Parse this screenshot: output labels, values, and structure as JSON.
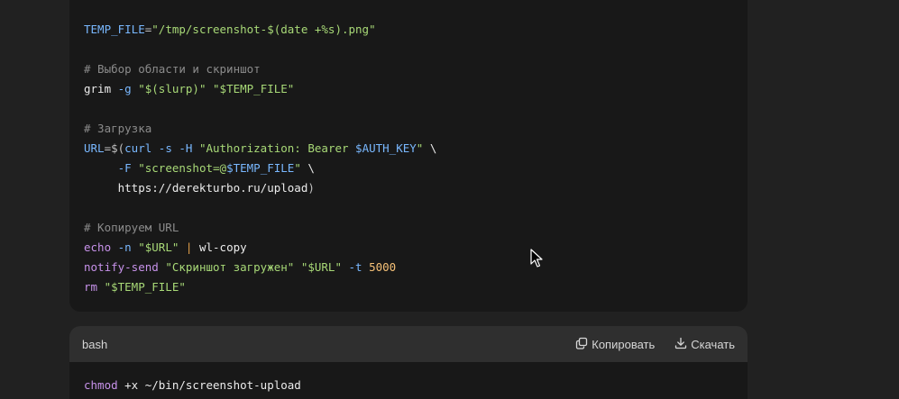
{
  "script_block": {
    "lines": [
      [
        {
          "t": "TEMP_FILE",
          "c": "v"
        },
        {
          "t": "=",
          "c": "p"
        },
        {
          "t": "\"/tmp/screenshot-$(date +%s).png\"",
          "c": "s"
        }
      ],
      [],
      [
        {
          "t": "# Выбор области и скриншот",
          "c": "c"
        }
      ],
      [
        {
          "t": "grim ",
          "c": ""
        },
        {
          "t": "-g ",
          "c": "v"
        },
        {
          "t": "\"$(slurp)\" ",
          "c": "s"
        },
        {
          "t": "\"$TEMP_FILE\"",
          "c": "s"
        }
      ],
      [],
      [
        {
          "t": "# Загрузка",
          "c": "c"
        }
      ],
      [
        {
          "t": "URL",
          "c": "v"
        },
        {
          "t": "=$(",
          "c": "p"
        },
        {
          "t": "curl ",
          "c": "v"
        },
        {
          "t": "-s ",
          "c": "v"
        },
        {
          "t": "-H ",
          "c": "v"
        },
        {
          "t": "\"Authorization: Bearer ",
          "c": "s"
        },
        {
          "t": "$AUTH_KEY",
          "c": "v"
        },
        {
          "t": "\" ",
          "c": "s"
        },
        {
          "t": "\\",
          "c": ""
        }
      ],
      [
        {
          "t": "     ",
          "c": ""
        },
        {
          "t": "-F ",
          "c": "v"
        },
        {
          "t": "\"screenshot=@",
          "c": "s"
        },
        {
          "t": "$TEMP_FILE",
          "c": "v"
        },
        {
          "t": "\" ",
          "c": "s"
        },
        {
          "t": "\\",
          "c": ""
        }
      ],
      [
        {
          "t": "     https://derekturbo.ru/upload",
          "c": ""
        },
        {
          "t": ")",
          "c": "p"
        }
      ],
      [],
      [
        {
          "t": "# Копируем URL",
          "c": "c"
        }
      ],
      [
        {
          "t": "echo ",
          "c": "k"
        },
        {
          "t": "-n ",
          "c": "v"
        },
        {
          "t": "\"$URL\" ",
          "c": "s"
        },
        {
          "t": "| ",
          "c": "o"
        },
        {
          "t": "wl-copy",
          "c": ""
        }
      ],
      [
        {
          "t": "notify-send ",
          "c": "k"
        },
        {
          "t": "\"Скриншот загружен\" ",
          "c": "s"
        },
        {
          "t": "\"$URL\" ",
          "c": "s"
        },
        {
          "t": "-t ",
          "c": "v"
        },
        {
          "t": "5000",
          "c": "n"
        }
      ],
      [
        {
          "t": "rm ",
          "c": "k"
        },
        {
          "t": "\"$TEMP_FILE\"",
          "c": "s"
        }
      ]
    ]
  },
  "bash_block": {
    "language": "bash",
    "copy_label": "Копировать",
    "download_label": "Скачать",
    "lines": [
      [
        {
          "t": "chmod ",
          "c": "k"
        },
        {
          "t": "+x ~/bin/screenshot-upload",
          "c": ""
        }
      ]
    ]
  }
}
